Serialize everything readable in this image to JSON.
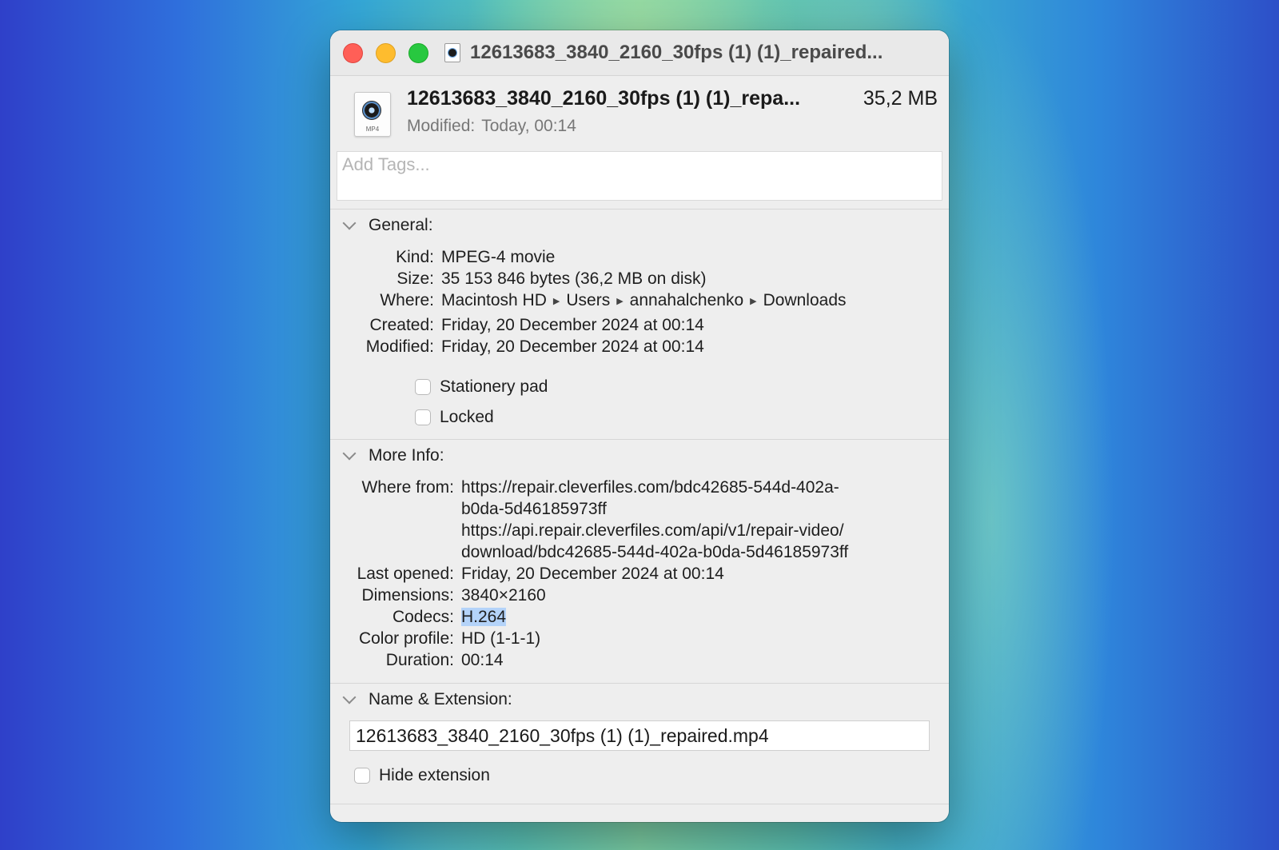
{
  "window": {
    "title": "12613683_3840_2160_30fps (1) (1)_repaired..."
  },
  "header": {
    "file_name": "12613683_3840_2160_30fps (1) (1)_repa...",
    "file_size": "35,2 MB",
    "modified_label": "Modified:",
    "modified_value": "Today, 00:14",
    "icon_ext": "MP4"
  },
  "tags": {
    "placeholder": "Add Tags..."
  },
  "general": {
    "heading": "General:",
    "kind_label": "Kind:",
    "kind_value": "MPEG-4 movie",
    "size_label": "Size:",
    "size_value": "35 153 846 bytes (36,2 MB on disk)",
    "where_label": "Where:",
    "where_path": [
      "Macintosh HD",
      "Users",
      "annahalchenko",
      "Downloads"
    ],
    "created_label": "Created:",
    "created_value": "Friday, 20 December 2024 at 00:14",
    "modified_label": "Modified:",
    "modified_value": "Friday, 20 December 2024 at 00:14",
    "stationery_label": "Stationery pad",
    "locked_label": "Locked"
  },
  "more_info": {
    "heading": "More Info:",
    "where_from_label": "Where from:",
    "where_from_lines": [
      "https://repair.cleverfiles.com/bdc42685-544d-402a-",
      "b0da-5d46185973ff",
      "https://api.repair.cleverfiles.com/api/v1/repair-video/",
      "download/bdc42685-544d-402a-b0da-5d46185973ff"
    ],
    "last_opened_label": "Last opened:",
    "last_opened_value": "Friday, 20 December 2024 at 00:14",
    "dimensions_label": "Dimensions:",
    "dimensions_value": "3840×2160",
    "codecs_label": "Codecs:",
    "codecs_value": "H.264",
    "color_profile_label": "Color profile:",
    "color_profile_value": "HD (1-1-1)",
    "duration_label": "Duration:",
    "duration_value": "00:14"
  },
  "name_extension": {
    "heading": "Name & Extension:",
    "file_name_value": "12613683_3840_2160_30fps (1) (1)_repaired.mp4",
    "hide_extension_label": "Hide extension"
  }
}
